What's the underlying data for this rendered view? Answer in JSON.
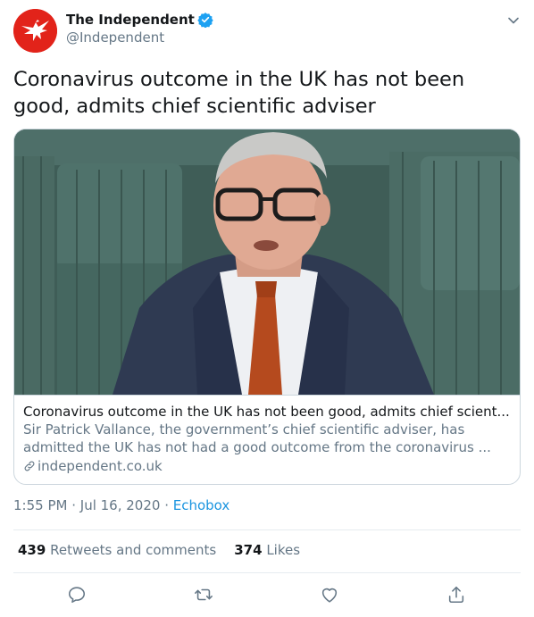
{
  "account": {
    "display_name": "The Independent",
    "handle": "@Independent",
    "verified": true,
    "avatar_color": "#e2231a"
  },
  "tweet": {
    "text": "Coronavirus outcome in the UK has not been good, admits chief scientific adviser"
  },
  "card": {
    "title": "Coronavirus outcome in the UK has not been good, admits chief scient...",
    "description_line1": "Sir Patrick Vallance, the government’s chief scientific adviser, has",
    "description_line2": "admitted the UK has not had a good outcome from the coronavirus ...",
    "domain": "independent.co.uk"
  },
  "meta": {
    "time": "1:55 PM",
    "date": "Jul 16, 2020",
    "separator": " · ",
    "source": "Echobox"
  },
  "stats": {
    "retweets_count": "439",
    "retweets_label": "Retweets and comments",
    "likes_count": "374",
    "likes_label": "Likes"
  },
  "icons": {
    "reply": "comment-icon",
    "retweet": "retweet-icon",
    "like": "heart-icon",
    "share": "share-icon",
    "caret": "chevron-down-icon",
    "verified": "verified-badge-icon",
    "link": "link-icon"
  },
  "colors": {
    "link_blue": "#1b95e0",
    "secondary_text": "#657786",
    "border": "#ccd6dd"
  }
}
